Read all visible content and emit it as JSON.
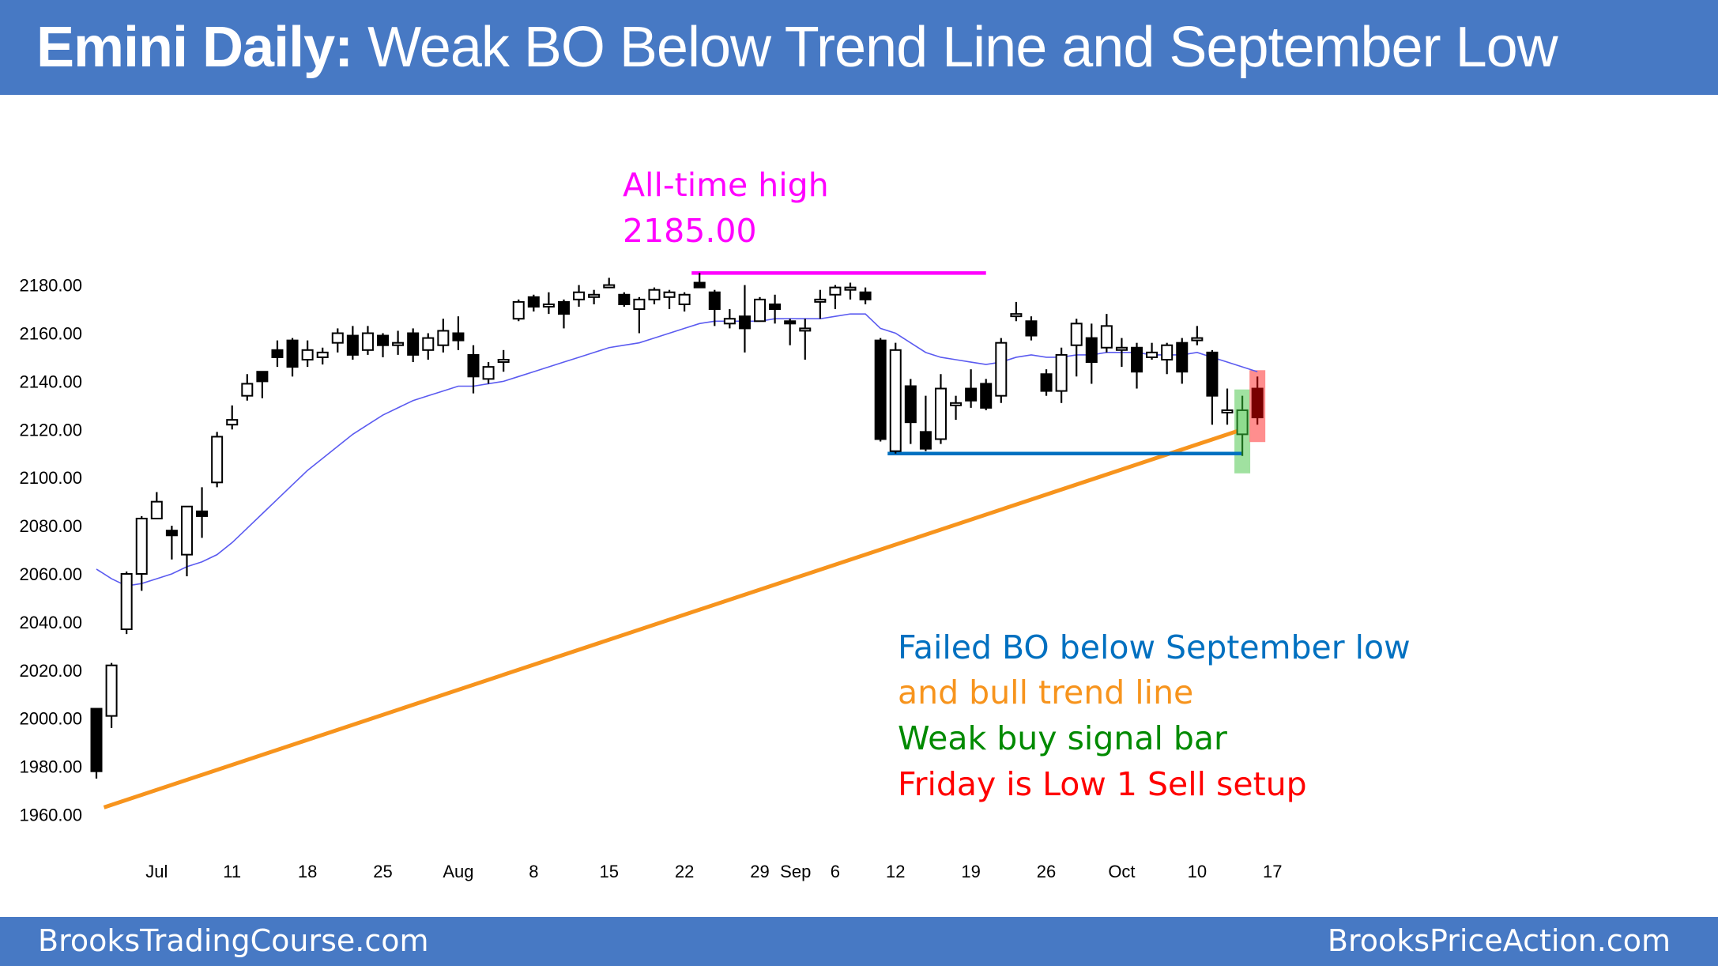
{
  "header": {
    "title_bold": "Emini Daily:",
    "title_rest": " Weak BO Below Trend Line and September Low"
  },
  "footer": {
    "left": "BrooksTradingCourse.com",
    "right": "BrooksPriceAction.com"
  },
  "annotations": {
    "ath_label": "All-time high",
    "ath_value": "2185.00",
    "notes": [
      {
        "text": "Failed BO below September low",
        "color": "#0070C0"
      },
      {
        "text": "and bull trend line",
        "color": "#F7941D"
      },
      {
        "text": "Weak buy signal bar",
        "color": "#008A00"
      },
      {
        "text": "Friday is Low 1 Sell setup",
        "color": "#FF0000"
      }
    ]
  },
  "chart_data": {
    "type": "candlestick",
    "title": "Emini Daily",
    "ylim": [
      1950,
      2190
    ],
    "yticks": [
      2180,
      2160,
      2140,
      2120,
      2100,
      2080,
      2060,
      2040,
      2020,
      2000,
      1980,
      1960
    ],
    "ytick_labels": [
      "2180.00",
      "2160.00",
      "2140.00",
      "2120.00",
      "2100.00",
      "2080.00",
      "2060.00",
      "2040.00",
      "2020.00",
      "2000.00",
      "1980.00",
      "1960.00"
    ],
    "xtick_labels": [
      {
        "label": "Jul",
        "bar": 4
      },
      {
        "label": "11",
        "bar": 9
      },
      {
        "label": "18",
        "bar": 14
      },
      {
        "label": "25",
        "bar": 19
      },
      {
        "label": "Aug",
        "bar": 24
      },
      {
        "label": "8",
        "bar": 29
      },
      {
        "label": "15",
        "bar": 34
      },
      {
        "label": "22",
        "bar": 39
      },
      {
        "label": "29",
        "bar": 44
      },
      {
        "label": "Sep",
        "bar": 47
      },
      {
        "label": "6",
        "bar": 49
      },
      {
        "label": "12",
        "bar": 53
      },
      {
        "label": "19",
        "bar": 58
      },
      {
        "label": "26",
        "bar": 63
      },
      {
        "label": "Oct",
        "bar": 68
      },
      {
        "label": "10",
        "bar": 73
      },
      {
        "label": "17",
        "bar": 78
      }
    ],
    "candles": [
      [
        2004,
        2004,
        1975,
        1978
      ],
      [
        2001,
        2023,
        1996,
        2022
      ],
      [
        2037,
        2061,
        2035,
        2060
      ],
      [
        2060,
        2084,
        2053,
        2083
      ],
      [
        2083,
        2094,
        2083,
        2090
      ],
      [
        2078,
        2080,
        2066,
        2076
      ],
      [
        2068,
        2088,
        2059,
        2088
      ],
      [
        2086,
        2096,
        2075,
        2084
      ],
      [
        2098,
        2119,
        2096,
        2117
      ],
      [
        2122,
        2130,
        2120,
        2124
      ],
      [
        2134,
        2143,
        2132,
        2139
      ],
      [
        2144,
        2144,
        2133,
        2140
      ],
      [
        2153,
        2157,
        2146,
        2150
      ],
      [
        2157,
        2158,
        2142,
        2146
      ],
      [
        2149,
        2157,
        2146,
        2153
      ],
      [
        2150,
        2154,
        2147,
        2152
      ],
      [
        2156,
        2162,
        2152,
        2160
      ],
      [
        2159,
        2163,
        2149,
        2151
      ],
      [
        2153,
        2163,
        2151,
        2160
      ],
      [
        2159,
        2160,
        2150,
        2155
      ],
      [
        2155,
        2161,
        2151,
        2156
      ],
      [
        2160,
        2162,
        2148,
        2151
      ],
      [
        2153,
        2160,
        2149,
        2158
      ],
      [
        2155,
        2166,
        2152,
        2161
      ],
      [
        2160,
        2167,
        2153,
        2157
      ],
      [
        2151,
        2155,
        2135,
        2142
      ],
      [
        2141,
        2148,
        2139,
        2146
      ],
      [
        2149,
        2153,
        2144,
        2149
      ],
      [
        2166,
        2174,
        2165,
        2173
      ],
      [
        2175,
        2176,
        2169,
        2171
      ],
      [
        2172,
        2177,
        2168,
        2172
      ],
      [
        2173,
        2174,
        2162,
        2168
      ],
      [
        2174,
        2180,
        2171,
        2177
      ],
      [
        2175,
        2178,
        2172,
        2176
      ],
      [
        2179,
        2183,
        2179,
        2180
      ],
      [
        2176,
        2177,
        2171,
        2172
      ],
      [
        2170,
        2175,
        2160,
        2174
      ],
      [
        2174,
        2179,
        2172,
        2178
      ],
      [
        2175,
        2178,
        2170,
        2177
      ],
      [
        2172,
        2177,
        2169,
        2176
      ],
      [
        2181,
        2185,
        2179,
        2179
      ],
      [
        2177,
        2178,
        2163,
        2170
      ],
      [
        2164,
        2170,
        2162,
        2166
      ],
      [
        2167,
        2180,
        2152,
        2162
      ],
      [
        2165,
        2175,
        2165,
        2174
      ],
      [
        2172,
        2176,
        2164,
        2170
      ],
      [
        2165,
        2166,
        2155,
        2164
      ],
      [
        2162,
        2166,
        2149,
        2162
      ],
      [
        2174,
        2178,
        2166,
        2174
      ],
      [
        2176,
        2180,
        2170,
        2179
      ],
      [
        2178,
        2181,
        2174,
        2179
      ],
      [
        2177,
        2179,
        2172,
        2174
      ],
      [
        2157,
        2158,
        2115,
        2116
      ],
      [
        2111,
        2156,
        2110,
        2153
      ],
      [
        2138,
        2141,
        2114,
        2123
      ],
      [
        2119,
        2134,
        2111,
        2112
      ],
      [
        2116,
        2143,
        2114,
        2137
      ],
      [
        2131,
        2134,
        2124,
        2131
      ],
      [
        2137,
        2145,
        2129,
        2132
      ],
      [
        2139,
        2141,
        2128,
        2129
      ],
      [
        2134,
        2158,
        2131,
        2156
      ],
      [
        2168,
        2173,
        2165,
        2168
      ],
      [
        2165,
        2167,
        2157,
        2159
      ],
      [
        2143,
        2145,
        2134,
        2136
      ],
      [
        2136,
        2154,
        2131,
        2151
      ],
      [
        2155,
        2166,
        2142,
        2164
      ],
      [
        2158,
        2164,
        2139,
        2148
      ],
      [
        2154,
        2168,
        2152,
        2163
      ],
      [
        2154,
        2158,
        2146,
        2154
      ],
      [
        2154,
        2156,
        2137,
        2144
      ],
      [
        2150,
        2156,
        2149,
        2152
      ],
      [
        2149,
        2156,
        2143,
        2155
      ],
      [
        2156,
        2158,
        2139,
        2144
      ],
      [
        2158,
        2163,
        2155,
        2158
      ],
      [
        2152,
        2153,
        2122,
        2134
      ],
      [
        2128,
        2137,
        2122,
        2128
      ],
      [
        2118,
        2134,
        2109,
        2128
      ],
      [
        2137,
        2142,
        2122,
        2125
      ]
    ],
    "candle_format": [
      "open",
      "high",
      "low",
      "close"
    ],
    "moving_average": {
      "name": "20-bar EMA",
      "color": "#5B5BF0",
      "values": [
        2062,
        2058,
        2055,
        2056,
        2058,
        2060,
        2063,
        2065,
        2068,
        2073,
        2079,
        2085,
        2091,
        2097,
        2103,
        2108,
        2113,
        2118,
        2122,
        2126,
        2129,
        2132,
        2134,
        2136,
        2138,
        2138,
        2139,
        2140,
        2142,
        2144,
        2146,
        2148,
        2150,
        2152,
        2154,
        2155,
        2156,
        2158,
        2160,
        2162,
        2164,
        2165,
        2165,
        2165,
        2165,
        2166,
        2166,
        2166,
        2166,
        2167,
        2168,
        2168,
        2162,
        2160,
        2156,
        2152,
        2150,
        2149,
        2148,
        2147,
        2148,
        2150,
        2151,
        2150,
        2150,
        2151,
        2151,
        2152,
        2152,
        2152,
        2151,
        2151,
        2151,
        2152,
        2150,
        2148,
        2146,
        2144
      ]
    },
    "lines": [
      {
        "name": "all-time-high",
        "value": 2185,
        "from_bar": 40,
        "to_bar": 59,
        "color": "#FF00FF"
      },
      {
        "name": "september-low",
        "value": 2110,
        "from_bar": 53,
        "to_bar": 76,
        "color": "#0070C0"
      },
      {
        "name": "bull-trend-line",
        "from": {
          "bar": 0.5,
          "value": 1963
        },
        "to": {
          "bar": 76,
          "value": 2120
        },
        "color": "#F7941D"
      }
    ],
    "highlights": [
      {
        "name": "weak-buy-signal-bar",
        "bar": 76,
        "color": "#8FDC8F"
      },
      {
        "name": "low-1-sell-setup",
        "bar": 77,
        "color": "#FF7A7A"
      }
    ]
  }
}
